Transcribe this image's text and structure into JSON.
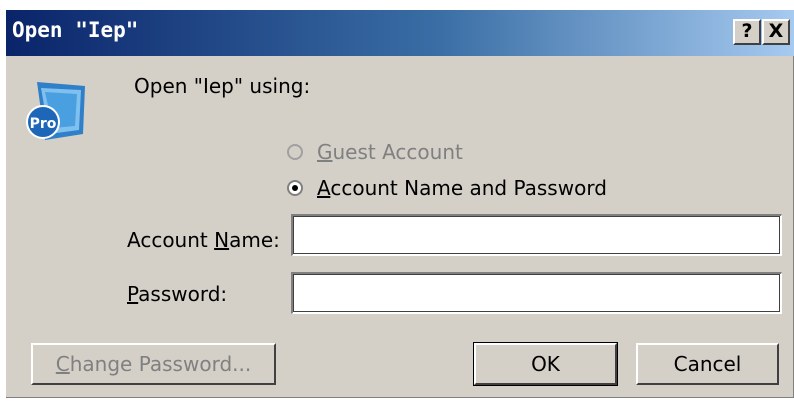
{
  "window": {
    "title": "Open \"Iep\"",
    "help_label": "?",
    "close_label": "X"
  },
  "prompt": "Open \"Iep\" using:",
  "options": {
    "guest": {
      "accel": "G",
      "rest": "uest Account",
      "enabled": false,
      "selected": false
    },
    "account": {
      "accel": "A",
      "rest": "ccount Name and Password",
      "enabled": true,
      "selected": true
    }
  },
  "fields": {
    "account_name": {
      "pre": "Account ",
      "accel": "N",
      "post": "ame:",
      "value": ""
    },
    "password": {
      "pre": "",
      "accel": "P",
      "post": "assword:",
      "value": ""
    }
  },
  "buttons": {
    "change_password": {
      "accel": "C",
      "rest": "hange Password...",
      "enabled": false
    },
    "ok": "OK",
    "cancel": "Cancel"
  },
  "icons": {
    "app": "filemaker-pro-icon"
  },
  "colors": {
    "face": "#d4d0c8",
    "title_start": "#0a246a",
    "title_end": "#a6caf0"
  }
}
